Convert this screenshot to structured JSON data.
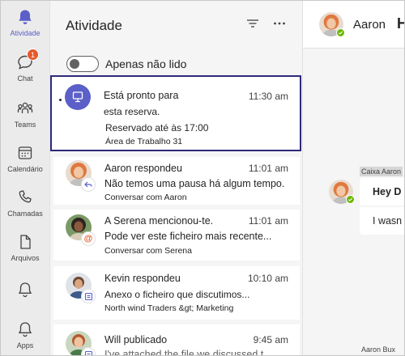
{
  "rail": {
    "items": [
      {
        "label": "Atividade",
        "icon": "bell-icon",
        "active": true
      },
      {
        "label": "Chat",
        "icon": "chat-icon",
        "badge": "1"
      },
      {
        "label": "Teams",
        "icon": "teams-icon"
      },
      {
        "label": "Calendário",
        "icon": "calendar-icon"
      },
      {
        "label": "Chamadas",
        "icon": "phone-icon"
      },
      {
        "label": "Arquivos",
        "icon": "file-icon"
      },
      {
        "label": "",
        "icon": "bell-icon"
      },
      {
        "label": "Apps",
        "icon": "apps-icon"
      }
    ]
  },
  "activity": {
    "title": "Atividade",
    "filter_icon": "filter-icon",
    "more_icon": "more-icon",
    "toggle_label": "Apenas não lido",
    "cards": [
      {
        "title": "Está pronto para",
        "time": "11:30 am",
        "line1": "esta reserva.",
        "line2": "Reservado até às 17:00",
        "sub": "Área de Trabalho 31",
        "icon": "desk-icon",
        "unread": true
      },
      {
        "title": "Aaron respondeu",
        "time": "11:01 am",
        "line1": "Não temos uma pausa há algum tempo.",
        "sub": "Conversar com Aaron",
        "badge_icon": "reply-icon"
      },
      {
        "title": "A Serena mencionou-te.",
        "time": "11:01 am",
        "line1": "Pode ver este ficheiro mais recente...",
        "sub": "Conversar com Serena",
        "badge_icon": "mention-icon"
      },
      {
        "title": "Kevin respondeu",
        "time": "10:10 am",
        "line1": "Anexo o ficheiro que discutimos...",
        "sub": "North wind Traders &gt; Marketing",
        "badge_icon": "channel-icon"
      },
      {
        "title": "Will publicado",
        "time": "9:45 am",
        "line1": "I've attached the file we discussed t...",
        "badge_icon": "channel-icon"
      }
    ]
  },
  "chat": {
    "name": "Aaron",
    "extra": "H",
    "sender_tag": "Caixa Aaron",
    "bubble1": "Hey D",
    "bubble2": "I wasn",
    "footer_name": "Aaron Bux"
  },
  "colors": {
    "accent": "#5b5fc7",
    "selected_border": "#2e2a7a",
    "badge": "#e55a2b",
    "presence": "#6bb700"
  }
}
